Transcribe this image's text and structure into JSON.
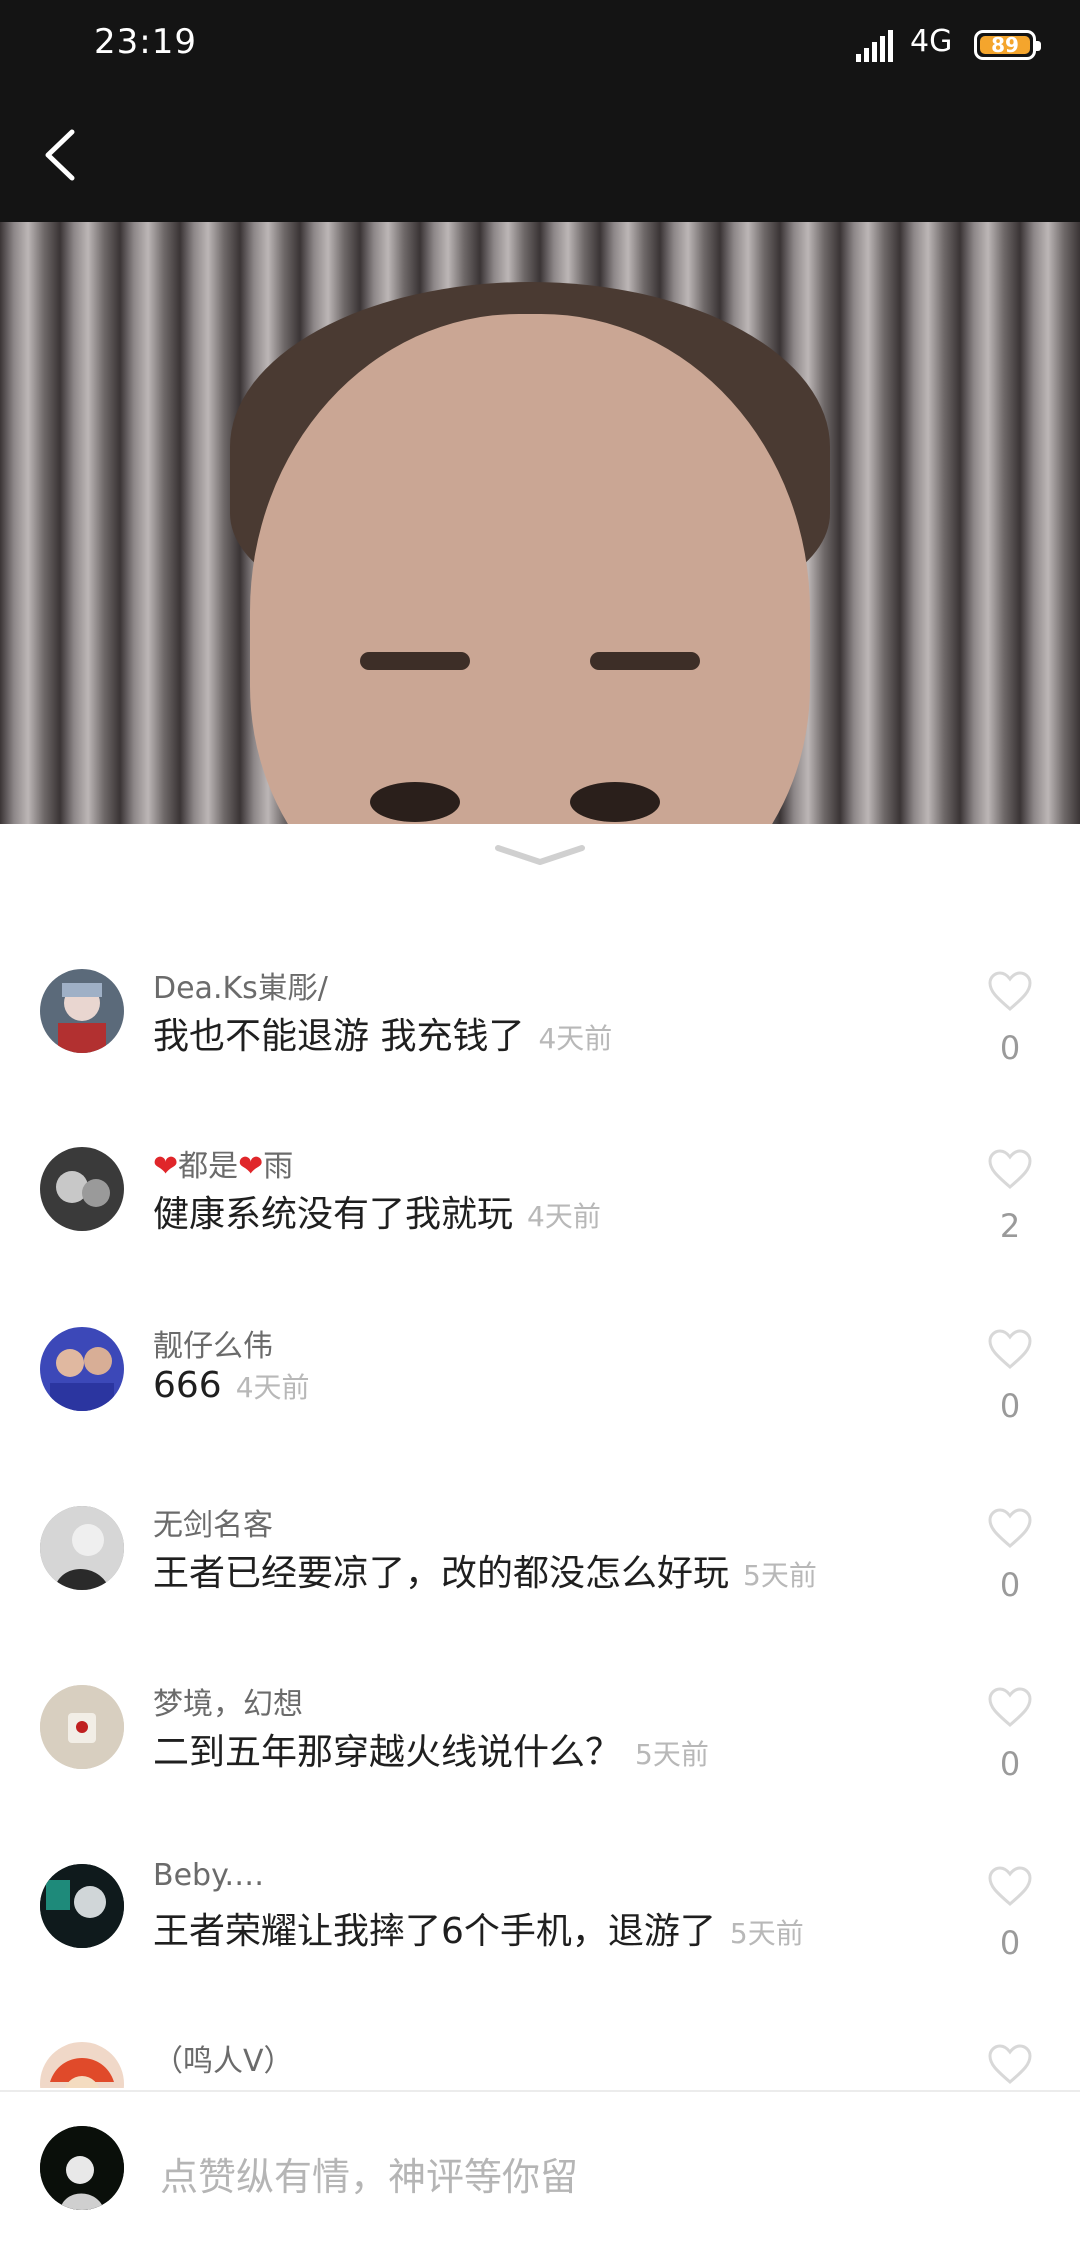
{
  "status": {
    "time": "23:19",
    "network": "4G",
    "battery": "89"
  },
  "comments": [
    {
      "username": "Dea.Ks崬彫/",
      "text": "我也不能退游  我充钱了",
      "time": "4天前",
      "likes": "0",
      "avatar_color": "#5b6a7a"
    },
    {
      "username_pre": "❤",
      "username_mid": "都是",
      "username_heart": "❤",
      "username_post": "雨",
      "text": "健康系统没有了我就玩",
      "time": "4天前",
      "likes": "2",
      "avatar_color": "#3a3a3a"
    },
    {
      "username": "靓仔么伟",
      "text": "666",
      "time": "4天前",
      "likes": "0",
      "avatar_color": "#3c48b8"
    },
    {
      "username": "无剑名客",
      "text": "王者已经要凉了，改的都没怎么好玩",
      "time": "5天前",
      "likes": "0",
      "avatar_color": "#8c8c8c"
    },
    {
      "username": "梦境，幻想",
      "text": "二到五年那穿越火线说什么？",
      "time": "5天前",
      "likes": "0",
      "avatar_color": "#d8cfc0"
    },
    {
      "username": "Beby.…",
      "text": "王者荣耀让我摔了6个手机，退游了",
      "time": "5天前",
      "likes": "0",
      "avatar_color": "#1a2a2a"
    }
  ],
  "partial_comment": {
    "username": "（鸣人V）",
    "avatar_color": "#e04a2a"
  },
  "input": {
    "placeholder": "点赞纵有情，神评等你留"
  }
}
